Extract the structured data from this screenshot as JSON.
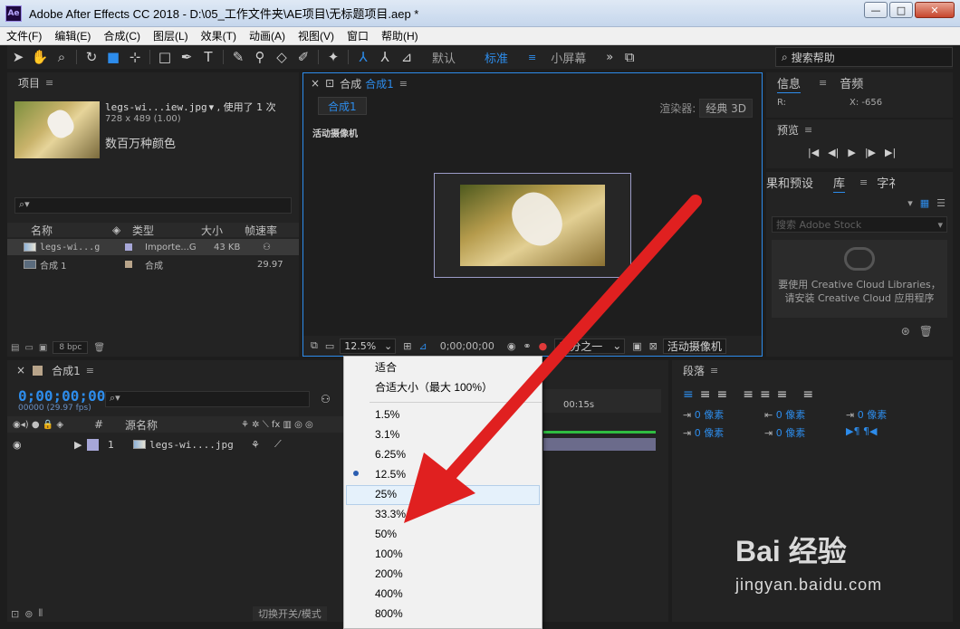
{
  "window": {
    "app_icon": "Ae",
    "title": "Adobe After Effects CC 2018 - D:\\05_工作文件夹\\AE项目\\无标题项目.aep *",
    "minimize": "—",
    "maximize": "□",
    "close": "✕"
  },
  "menu": [
    "文件(F)",
    "编辑(E)",
    "合成(C)",
    "图层(L)",
    "效果(T)",
    "动画(A)",
    "视图(V)",
    "窗口",
    "帮助(H)"
  ],
  "toolbar": {
    "workspaces": [
      "默认",
      "标准",
      "小屏幕"
    ],
    "active_workspace": "标准",
    "more": "»",
    "search_placeholder": "搜索帮助"
  },
  "project": {
    "title": "项目",
    "item_name": "legs-wi...iew.jpg",
    "used": "▾ , 使用了 1 次",
    "dims": "728 x 489 (1.00)",
    "color": "数百万种颜色",
    "search_icon": "⌕▾",
    "columns": [
      "名称",
      "类型",
      "大小",
      "帧速率"
    ],
    "rows": [
      {
        "name": "legs-wi...g",
        "type": "Importe...G",
        "size": "43 KB",
        "fps": ""
      },
      {
        "name": "合成 1",
        "type": "合成",
        "size": "",
        "fps": "29.97"
      }
    ],
    "bpc": "8 bpc"
  },
  "viewer": {
    "tab_title": "合成",
    "tab_link": "合成1",
    "comp_tab": "合成1",
    "renderer_label": "渲染器:",
    "renderer_value": "经典 3D",
    "camera_label": "活动摄像机",
    "zoom": "12.5%",
    "timecode": "0;00;00;00",
    "grid": "三分之一",
    "camera_dropdown": "活动摄像机"
  },
  "info": {
    "tabs": [
      "信息",
      "音频"
    ],
    "r_label": "R:",
    "x_label": "X: -656"
  },
  "preview": {
    "title": "预览",
    "controls": [
      "|◀",
      "◀|",
      "▶",
      "|▶",
      "▶|"
    ]
  },
  "effects": {
    "tabs": [
      "果和预设",
      "库",
      "字礻"
    ],
    "stock_placeholder": "搜索 Adobe Stock",
    "cc_line1": "要使用 Creative Cloud Libraries，",
    "cc_line2": "请安装 Creative Cloud 应用程序"
  },
  "timeline": {
    "title": "合成1",
    "timecode": "0;00;00;00",
    "fps": "00000 (29.97 fps)",
    "search_icon": "⌕▾",
    "ruler_label": "00:15s",
    "columns": [
      "#",
      "源名称"
    ],
    "layer_index": "1",
    "layer_name": "legs-wi....jpg",
    "footer": "切换开关/模式"
  },
  "paragraph": {
    "title": "段落",
    "indent": [
      "0 像素",
      "0 像素",
      "0 像素",
      "0 像素",
      "0 像素"
    ]
  },
  "zoom_menu": {
    "fit": "适合",
    "fit_max": "合适大小（最大 100%）",
    "items": [
      "1.5%",
      "3.1%",
      "6.25%",
      "12.5%",
      "25%",
      "33.3%",
      "50%",
      "100%",
      "200%",
      "400%",
      "800%"
    ],
    "selected": "12.5%",
    "highlighted": "25%"
  },
  "watermark": {
    "logo": "Bai 经验",
    "url": "jingyan.baidu.com"
  },
  "colors": {
    "accent": "#2d8ceb",
    "arrow": "#e02020",
    "panel": "#232323"
  }
}
